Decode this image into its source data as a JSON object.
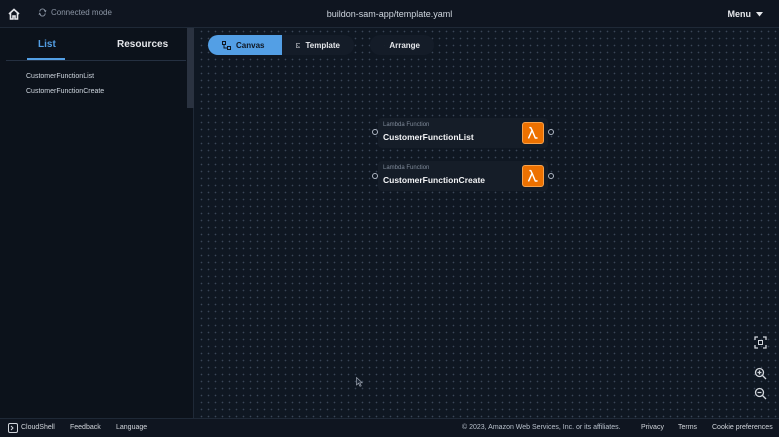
{
  "header": {
    "connection_status": "Connected mode",
    "file_title": "buildon-sam-app/template.yaml",
    "menu_label": "Menu"
  },
  "sidebar": {
    "tabs": [
      {
        "label": "List",
        "active": true
      },
      {
        "label": "Resources",
        "active": false
      }
    ],
    "items": [
      "CustomerFunctionList",
      "CustomerFunctionCreate"
    ]
  },
  "toolbar": {
    "canvas_label": "Canvas",
    "template_label": "Template",
    "arrange_label": "Arrange"
  },
  "nodes": [
    {
      "type_label": "Lambda Function",
      "name": "CustomerFunctionList",
      "icon": "lambda-icon"
    },
    {
      "type_label": "Lambda Function",
      "name": "CustomerFunctionCreate",
      "icon": "lambda-icon"
    }
  ],
  "canvas_controls": [
    "fit-view-icon",
    "zoom-in-icon",
    "zoom-out-icon"
  ],
  "footer": {
    "cloudshell": "CloudShell",
    "feedback": "Feedback",
    "language": "Language",
    "copyright": "© 2023, Amazon Web Services, Inc. or its affiliates.",
    "privacy": "Privacy",
    "terms": "Terms",
    "cookie": "Cookie preferences"
  },
  "colors": {
    "accent": "#539fe5",
    "lambda": "#ed7100",
    "background": "#0f1722"
  }
}
